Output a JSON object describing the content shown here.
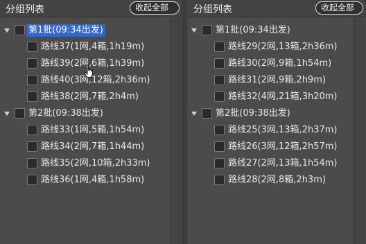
{
  "panels": [
    {
      "title": "分组列表",
      "collapse_label": "收起全部",
      "groups": [
        {
          "label": "第1批(09:34出发)",
          "selected": true,
          "routes": [
            "路线37(1网,4箱,1h19m)",
            "路线39(2网,6箱,1h39m)",
            "路线40(3网,12箱,2h36m)",
            "路线38(2网,7箱,2h4m)"
          ]
        },
        {
          "label": "第2批(09:38出发)",
          "selected": false,
          "routes": [
            "路线33(1网,5箱,1h54m)",
            "路线34(2网,7箱,1h44m)",
            "路线35(2网,10箱,2h33m)",
            "路线36(1网,4箱,1h58m)"
          ]
        }
      ]
    },
    {
      "title": "分组列表",
      "collapse_label": "收起全部",
      "groups": [
        {
          "label": "第1批(09:34出发)",
          "selected": false,
          "routes": [
            "路线29(2网,13箱,2h36m)",
            "路线30(2网,9箱,1h54m)",
            "路线31(2网,9箱,2h9m)",
            "路线32(4网,21箱,3h20m)"
          ]
        },
        {
          "label": "第2批(09:38出发)",
          "selected": false,
          "routes": [
            "路线25(3网,13箱,2h37m)",
            "路线26(3网,12箱,2h57m)",
            "路线27(2网,13箱,1h54m)",
            "路线28(2网,8箱,2h3m)"
          ]
        }
      ]
    }
  ],
  "colors": {
    "selection": "#2f66cf",
    "panel_bg": "#4b4b4b"
  },
  "pointer": "hand-pointer-icon"
}
